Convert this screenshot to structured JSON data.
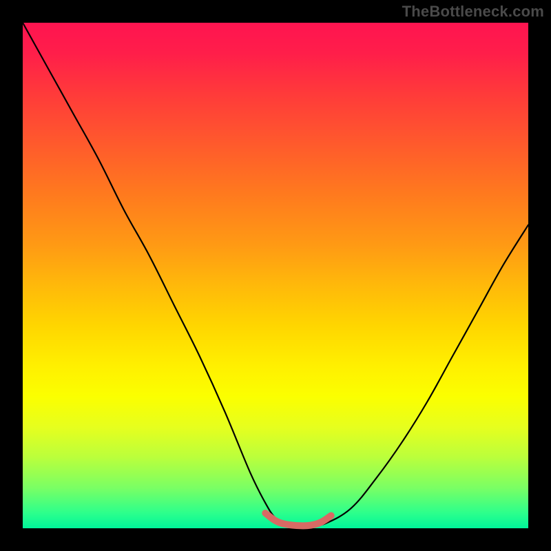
{
  "watermark": "TheBottleneck.com",
  "colors": {
    "frame": "#000000",
    "curve": "#000000",
    "sweet_spot": "#d86a64",
    "gradient_top": "#ff1450",
    "gradient_mid": "#fff000",
    "gradient_bottom": "#00f59a"
  },
  "chart_data": {
    "type": "line",
    "title": "",
    "xlabel": "",
    "ylabel": "",
    "xlim": [
      0,
      100
    ],
    "ylim": [
      0,
      100
    ],
    "grid": false,
    "legend": false,
    "series": [
      {
        "name": "bottleneck-curve",
        "x": [
          0,
          5,
          10,
          15,
          20,
          25,
          30,
          35,
          40,
          45,
          48,
          50,
          52,
          55,
          57,
          60,
          65,
          70,
          75,
          80,
          85,
          90,
          95,
          100
        ],
        "y": [
          100,
          91,
          82,
          73,
          63,
          54,
          44,
          34,
          23,
          11,
          5,
          2,
          1,
          0.5,
          0.5,
          1,
          4,
          10,
          17,
          25,
          34,
          43,
          52,
          60
        ]
      },
      {
        "name": "sweet-spot-band",
        "x": [
          48,
          50,
          52,
          55,
          57,
          59,
          61
        ],
        "y": [
          3,
          1.5,
          0.8,
          0.5,
          0.6,
          1.2,
          2.5
        ]
      }
    ],
    "annotations": []
  }
}
